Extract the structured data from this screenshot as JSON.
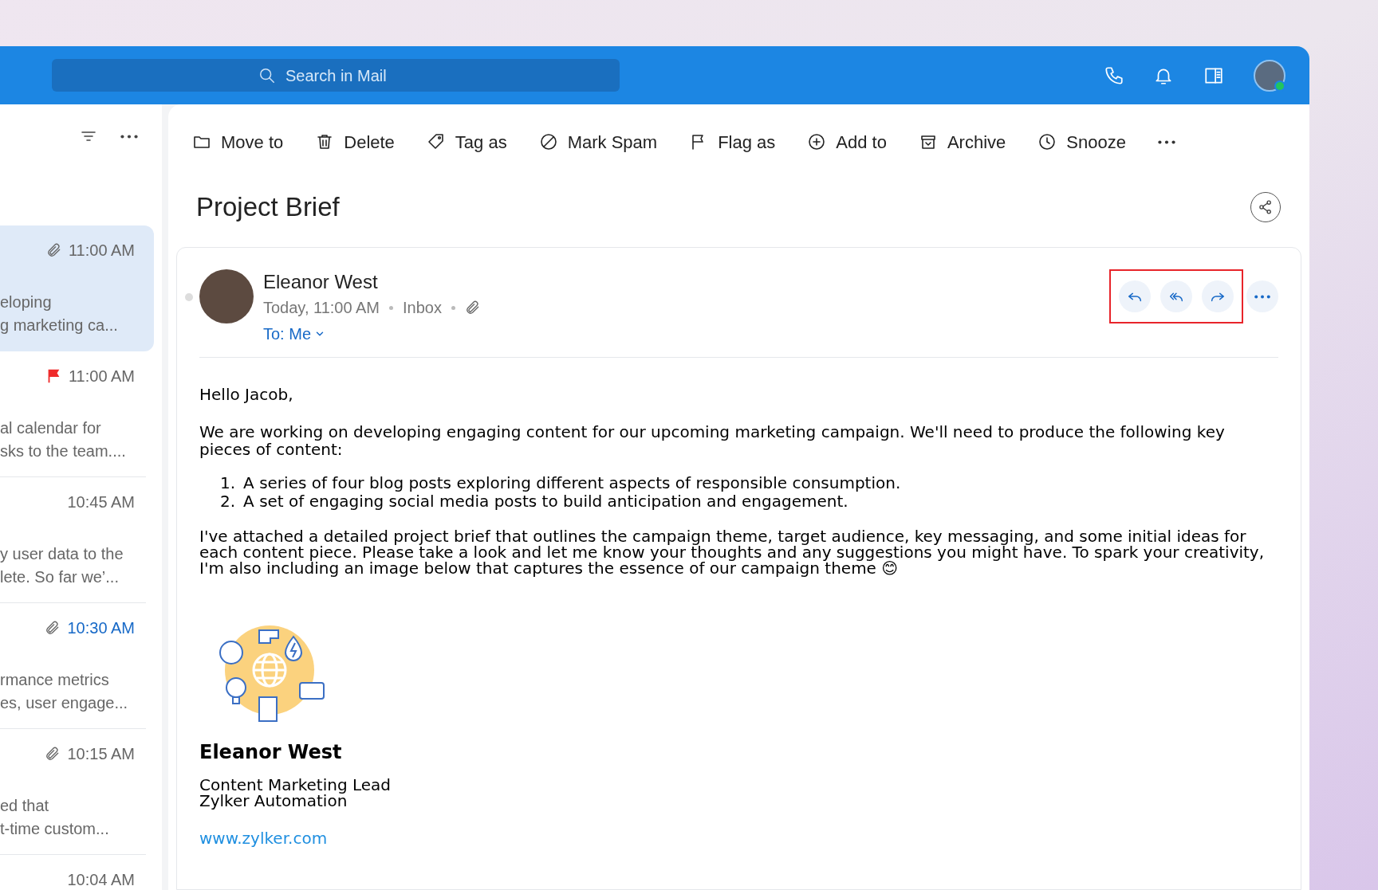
{
  "header": {
    "search": {
      "placeholder": "Search in Mail"
    },
    "avatar_online": true
  },
  "message_list": [
    {
      "time": "11:00 AM",
      "kind": "attachment",
      "selected": true,
      "unread": false,
      "preview": [
        "eloping",
        "g marketing ca..."
      ]
    },
    {
      "time": "11:00 AM",
      "kind": "flag",
      "selected": false,
      "unread": false,
      "preview": [
        "al calendar for",
        "sks to the team...."
      ]
    },
    {
      "time": "10:45 AM",
      "kind": "plain",
      "selected": false,
      "unread": false,
      "preview": [
        "y user data to the",
        "lete. So far we’..."
      ]
    },
    {
      "time": "10:30 AM",
      "kind": "attachment",
      "selected": false,
      "unread": true,
      "preview": [
        "rmance metrics",
        "es, user engage..."
      ]
    },
    {
      "time": "10:15 AM",
      "kind": "attachment",
      "selected": false,
      "unread": false,
      "preview": [
        "ed that",
        "t-time custom..."
      ]
    },
    {
      "time": "10:04 AM",
      "kind": "plain",
      "selected": false,
      "unread": false
    }
  ],
  "toolbar": [
    {
      "kind": "folder",
      "label": "Move to"
    },
    {
      "kind": "trash",
      "label": "Delete"
    },
    {
      "kind": "tag",
      "label": "Tag as"
    },
    {
      "kind": "spam",
      "label": "Mark Spam"
    },
    {
      "kind": "flag",
      "label": "Flag as"
    },
    {
      "kind": "add",
      "label": "Add to"
    },
    {
      "kind": "archive",
      "label": "Archive"
    },
    {
      "kind": "clock",
      "label": "Snooze"
    }
  ],
  "subject": "Project Brief",
  "message": {
    "sender": "Eleanor West",
    "date": "Today, 11:00 AM",
    "folder": "Inbox",
    "has_attachment": true,
    "to": "To: Me",
    "reply_actions_highlighted": true,
    "body": {
      "greeting": "Hello Jacob,",
      "intro": "We are working on developing engaging content for our upcoming marketing campaign. We'll need to produce the following key pieces of content:",
      "list": [
        {
          "number": "1.",
          "text": "A series of four blog posts exploring different aspects of responsible consumption."
        },
        {
          "number": "2.",
          "text": "A set of engaging social media posts to build anticipation and engagement."
        }
      ],
      "closing": "I've attached a detailed project brief that outlines the campaign theme, target audience, key messaging, and some initial ideas for each content piece. Please take a look and let me know your thoughts and any suggestions you might have. To spark your creativity, I'm also including an image below that captures the essence of our campaign theme 😊"
    },
    "signature": {
      "name": "Eleanor West",
      "title": "Content Marketing Lead",
      "company": "Zylker Automation",
      "link": "www.zylker.com"
    }
  }
}
